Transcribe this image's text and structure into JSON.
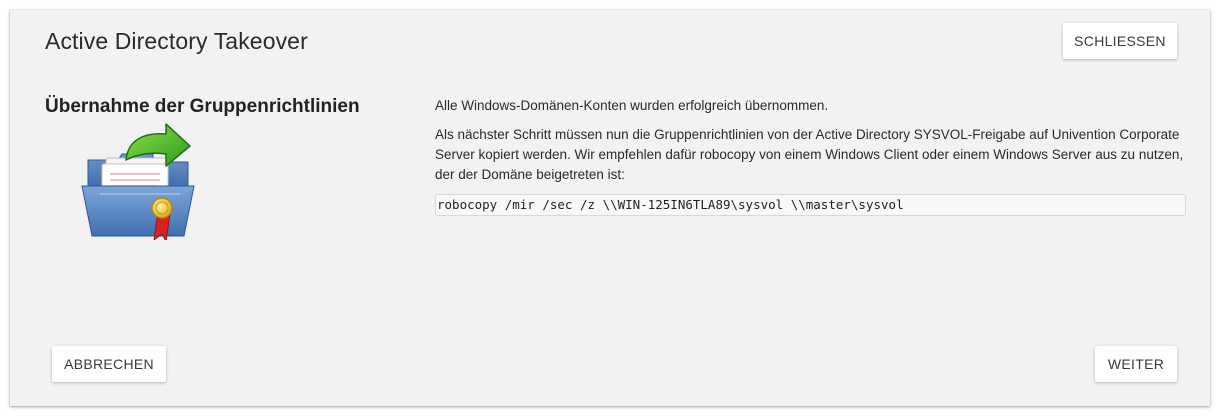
{
  "dialog": {
    "title": "Active Directory Takeover",
    "close_label": "SCHLIESSEN",
    "cancel_label": "ABBRECHEN",
    "next_label": "WEITER"
  },
  "page": {
    "subtitle": "Übernahme der Gruppenrichtlinien",
    "icon": "folder-certificate-arrow-icon",
    "paragraph_1": "Alle Windows-Domänen-Konten wurden erfolgreich übernommen.",
    "paragraph_2": "Als nächster Schritt müssen nun die Gruppenrichtlinien von der Active Directory SYSVOL-Freigabe auf Univention Corporate Server kopiert werden. Wir empfehlen dafür robocopy von einem Windows Client oder einem Windows Server aus zu nutzen, der der Domäne beigetreten ist:",
    "command": "robocopy /mir /sec /z \\\\WIN-125IN6TLA89\\sysvol \\\\master\\sysvol"
  }
}
